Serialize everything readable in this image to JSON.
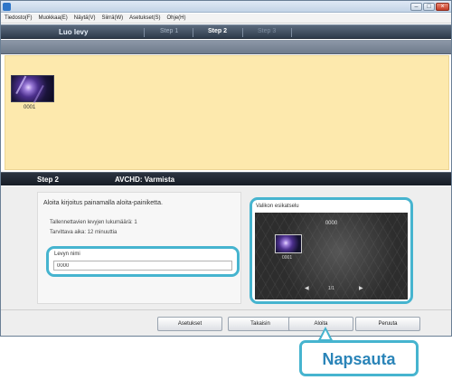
{
  "window": {
    "title": ""
  },
  "menu": {
    "items": [
      "Tiedosto(F)",
      "Muokkaa(E)",
      "Näytä(V)",
      "Siirrä(W)",
      "Asetukset(S)",
      "Ohje(H)"
    ]
  },
  "steps": {
    "title": "Luo levy",
    "tabs": [
      "Step 1",
      "Step 2",
      "Step 3"
    ],
    "active_tab": "Step 2"
  },
  "clip": {
    "label": "0001"
  },
  "status": {
    "step": "Step 2",
    "label": "AVCHD: Varmista"
  },
  "details": {
    "heading": "Aloita kirjoitus painamalla aloita-painiketta.",
    "lines": [
      "Tallennettavien levyjen lukumäärä: 1",
      "Tarvittava aika: 12 minuuttia"
    ]
  },
  "disc_name": {
    "label": "Levyn nimi",
    "value": "0000"
  },
  "preview": {
    "title": "Valikon esikatselu",
    "menu_title": "0000",
    "thumb_label": "0001",
    "page": "1/1"
  },
  "buttons": {
    "settings": "Asetukset",
    "back": "Takaisin",
    "start": "Aloita",
    "cancel": "Peruuta"
  },
  "callout": {
    "text": "Napsauta"
  },
  "colors": {
    "highlight": "#46b4cf",
    "callout_text": "#2a84b8",
    "content_bg": "#fde9ad"
  }
}
